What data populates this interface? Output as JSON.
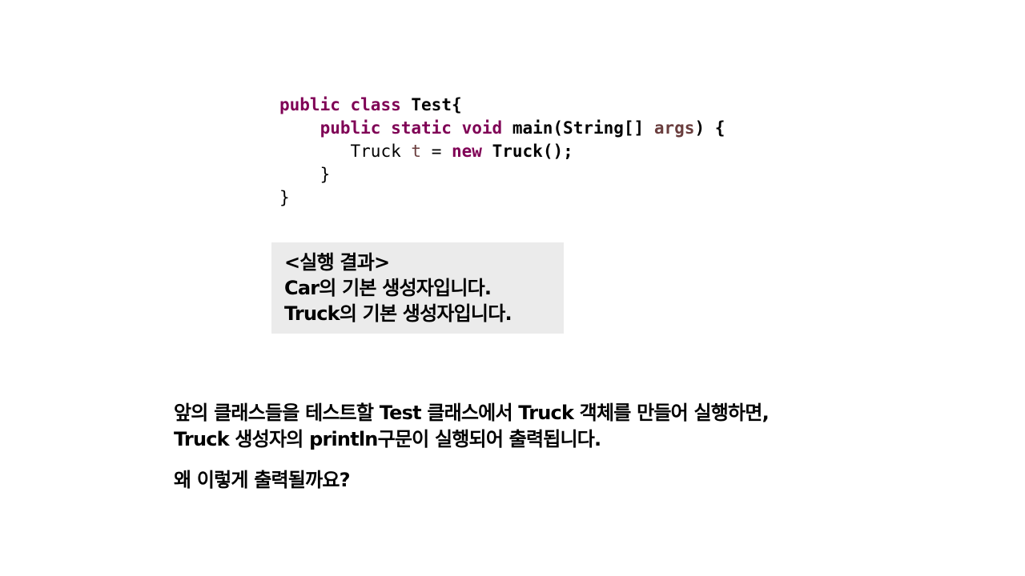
{
  "code": {
    "line1": {
      "kw1": "public",
      "kw2": "class",
      "name": "Test{"
    },
    "line2": {
      "kw1": "public",
      "kw2": "static",
      "kw3": "void",
      "fn": "main(String[]",
      "arg": "args",
      "tail": ") {"
    },
    "line3": {
      "type": "Truck",
      "var": "t",
      "eq": "=",
      "kw": "new",
      "ctor": "Truck();"
    },
    "line4": "}",
    "line5": "}"
  },
  "result": {
    "heading": "<실행 결과>",
    "lines": [
      "Car의 기본 생성자입니다.",
      "Truck의 기본 생성자입니다."
    ]
  },
  "explanation": {
    "p1": "앞의 클래스들을 테스트할 Test 클래스에서 Truck 객체를 만들어 실행하면,",
    "p2": "Truck 생성자의 println구문이 실행되어 출력됩니다.",
    "question": "왜 이렇게 출력될까요?"
  },
  "colors": {
    "keyword": "#7f0055",
    "variable": "#6a3e3e",
    "result_bg": "#ebebeb"
  }
}
